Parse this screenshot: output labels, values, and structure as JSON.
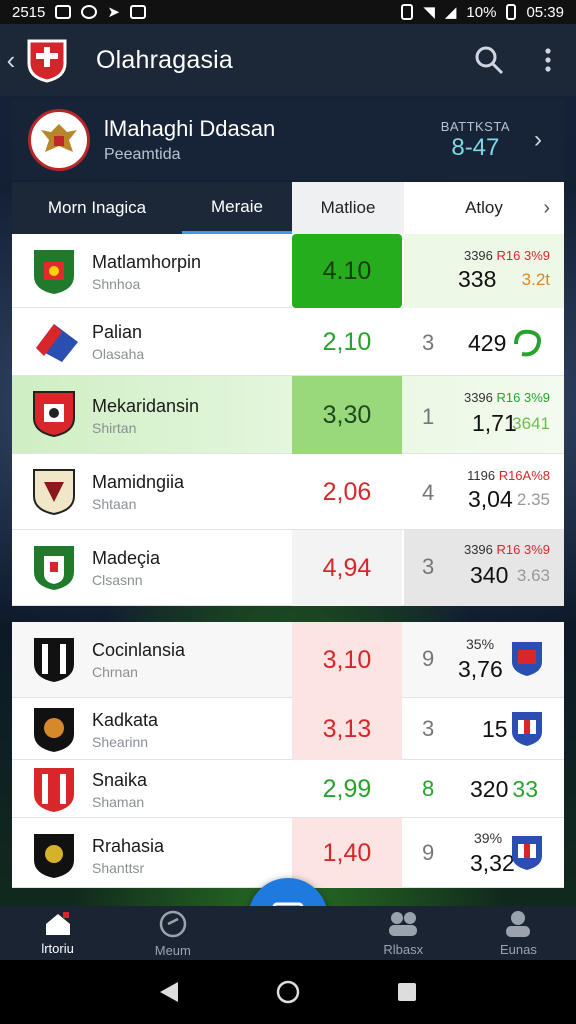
{
  "status_bar": {
    "time_left": "2515",
    "battery": "10%",
    "time_right": "05:39"
  },
  "app_bar": {
    "title": "Olahragasia"
  },
  "league": {
    "name": "lMahaghi Ddasan",
    "subtitle": "Peeamtida",
    "right_label": "BATTKSTA",
    "right_value": "8-47"
  },
  "tabs": [
    "Morn Inagica",
    "Meraie",
    "Matlioe",
    "Atloy"
  ],
  "matches": [
    {
      "team": "Matlamhorpin",
      "sub": "Shnhoa",
      "odd": "4.10",
      "odd_color": "#2e7d2e",
      "side": "",
      "r1a": "3396",
      "r1b": "R16 3%9",
      "r2": "338",
      "r3": "3.2t"
    },
    {
      "team": "Palian",
      "sub": "Olasaha",
      "odd": "2,10",
      "odd_color": "#27a22c",
      "side": "3",
      "r1a": "",
      "r1b": "",
      "r2": "429",
      "r3": ""
    },
    {
      "team": "Mekaridansin",
      "sub": "Shirtan",
      "odd": "3,30",
      "odd_color": "#1f6b2a",
      "side": "1",
      "r1a": "3396",
      "r1b": "R16 3%9",
      "r2": "1,71",
      "r3": "3641"
    },
    {
      "team": "Mamidngiia",
      "sub": "Shtaan",
      "odd": "2,06",
      "odd_color": "#d8262b",
      "side": "4",
      "r1a": "1196",
      "r1b": "R16A%8",
      "r2": "3,04",
      "r3": "2.35"
    },
    {
      "team": "Madeçia",
      "sub": "Clsasnn",
      "odd": "4,94",
      "odd_color": "#d8262b",
      "side": "3",
      "r1a": "3396",
      "r1b": "R16 3%9",
      "r2": "340",
      "r3": "3.63"
    },
    {
      "team": "Cocinlansia",
      "sub": "Chrnan",
      "odd": "3,10",
      "odd_color": "#d8262b",
      "side": "9",
      "r1a": "",
      "r1b": "35%",
      "r2": "3,76",
      "r3": ""
    },
    {
      "team": "Kadkata",
      "sub": "Shearinn",
      "odd": "3,13",
      "odd_color": "#d8262b",
      "side": "3",
      "r1a": "",
      "r1b": "",
      "r2": "15",
      "r3": ""
    },
    {
      "team": "Snaika",
      "sub": "Shaman",
      "odd": "2,99",
      "odd_color": "#27a22c",
      "side": "8",
      "r1a": "",
      "r1b": "",
      "r2": "320",
      "r3": "33"
    },
    {
      "team": "Rrahasia",
      "sub": "Shanttsr",
      "odd": "1,40",
      "odd_color": "#d8262b",
      "side": "9",
      "r1a": "",
      "r1b": "39%",
      "r2": "3,32",
      "r3": ""
    }
  ],
  "bottom_nav": [
    "lrtoriu",
    "Meum",
    "Rlbasx",
    "Eunas"
  ],
  "colors": {
    "green": "#27a22c",
    "red": "#d8262b",
    "accent_blue": "#1f7ae0"
  }
}
